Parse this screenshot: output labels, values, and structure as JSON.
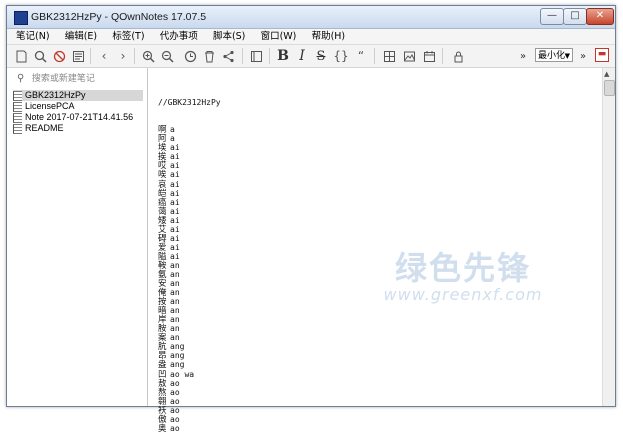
{
  "window": {
    "title": "GBK2312HzPy - QOwnNotes 17.07.5",
    "min_label": "—",
    "max_label": "□",
    "close_label": "✕"
  },
  "menu": [
    "笔记(N)",
    "编辑(E)",
    "标签(T)",
    "代办事项",
    "脚本(S)",
    "窗口(W)",
    "帮助(H)"
  ],
  "toolbar": {
    "bold": "B",
    "italic": "I",
    "strike": "S",
    "braces": "{}",
    "quote": "“",
    "zoom_value": "最小化",
    "overflow": "»",
    "overflow2": "»"
  },
  "sidebar": {
    "search_placeholder": "搜索或新建笔记",
    "notes": [
      "GBK2312HzPy",
      "LicensePCA",
      "Note 2017-07-21T14.41.56",
      "README"
    ]
  },
  "editor": {
    "first_line": "//GBK2312HzPy",
    "lines": [
      [
        "啊",
        "a"
      ],
      [
        "阿",
        "a"
      ],
      [
        "埃",
        "ai"
      ],
      [
        "挨",
        "ai"
      ],
      [
        "哎",
        "ai"
      ],
      [
        "唉",
        "ai"
      ],
      [
        "哀",
        "ai"
      ],
      [
        "皑",
        "ai"
      ],
      [
        "癌",
        "ai"
      ],
      [
        "蔼",
        "ai"
      ],
      [
        "矮",
        "ai"
      ],
      [
        "艾",
        "ai"
      ],
      [
        "碍",
        "ai"
      ],
      [
        "爱",
        "ai"
      ],
      [
        "隘",
        "ai"
      ],
      [
        "鞍",
        "an"
      ],
      [
        "氨",
        "an"
      ],
      [
        "安",
        "an"
      ],
      [
        "俺",
        "an"
      ],
      [
        "按",
        "an"
      ],
      [
        "暗",
        "an"
      ],
      [
        "岸",
        "an"
      ],
      [
        "胺",
        "an"
      ],
      [
        "案",
        "an"
      ],
      [
        "肮",
        "ang"
      ],
      [
        "昂",
        "ang"
      ],
      [
        "盎",
        "ang"
      ],
      [
        "凹",
        "ao wa"
      ],
      [
        "敖",
        "ao"
      ],
      [
        "熬",
        "ao"
      ],
      [
        "翱",
        "ao"
      ],
      [
        "袄",
        "ao"
      ],
      [
        "傲",
        "ao"
      ],
      [
        "奥",
        "ao"
      ]
    ]
  },
  "watermark": {
    "cn": "绿色先锋",
    "en": "www.greenxf.com"
  }
}
